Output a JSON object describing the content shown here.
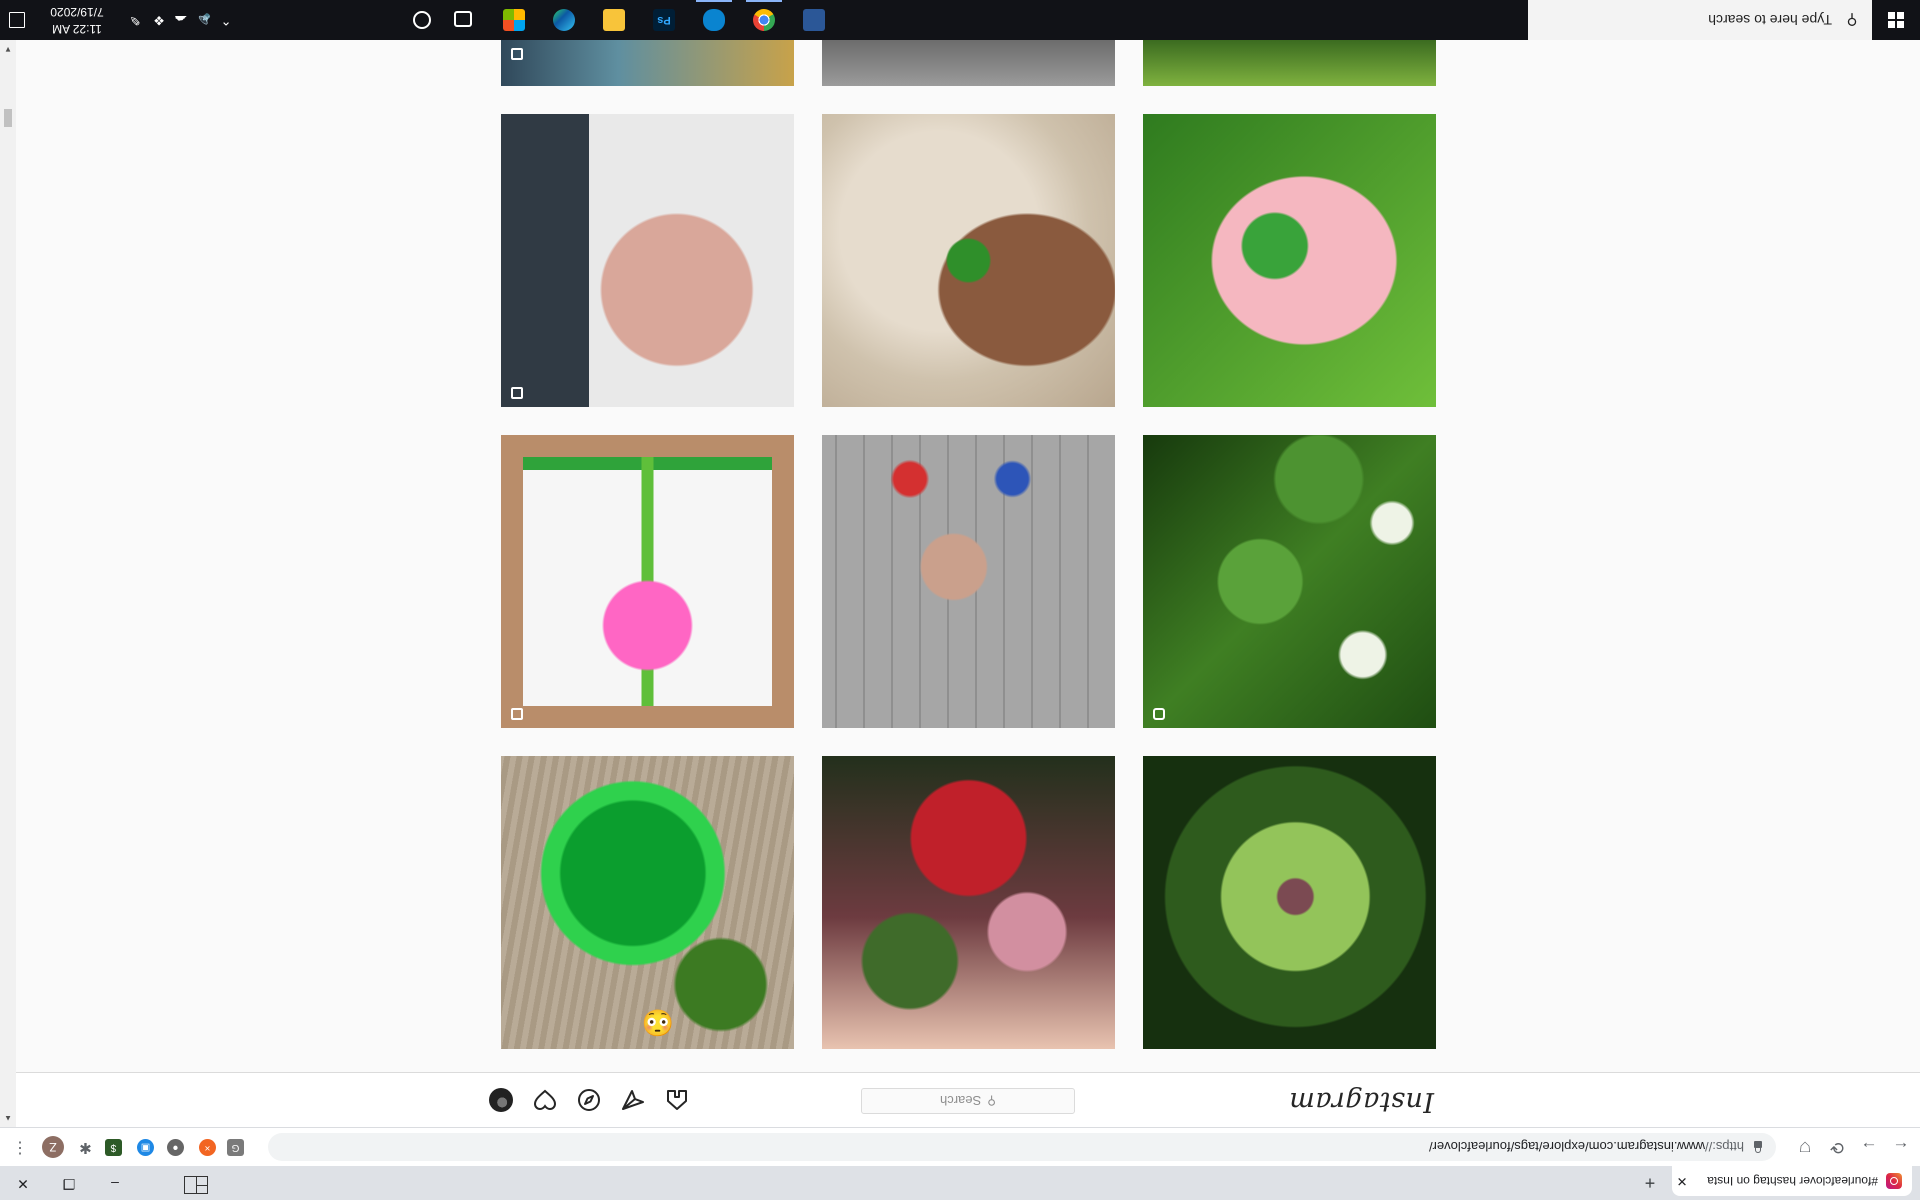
{
  "browser": {
    "tab_title": "#fourleafclover hashtag on Insta",
    "tab_close": "✕",
    "new_tab": "+",
    "url_scheme": "https://",
    "url_rest": "www.instagram.com/explore/tags/fourleafclover/",
    "profile_initial": "Z",
    "menu": "⋮",
    "back": "←",
    "forward": "→",
    "reload": "⟳",
    "minimize": "–",
    "restore": "❐",
    "close": "✕"
  },
  "instagram": {
    "logo": "Instagram",
    "search_placeholder": "Search",
    "search_icon": "⚲"
  },
  "grid": {
    "tiles": [
      {
        "name": "post-oxalis-clover",
        "icon": "none"
      },
      {
        "name": "post-fantasy-art",
        "icon": "none"
      },
      {
        "name": "post-green-cap-clover",
        "icon": "emoji"
      },
      {
        "name": "post-white-clover-field",
        "icon": "video-icon"
      },
      {
        "name": "post-pavement-clover",
        "icon": "none"
      },
      {
        "name": "post-paper-flower-craft",
        "icon": "carousel-icon"
      },
      {
        "name": "post-pink-hand-clover",
        "icon": "none"
      },
      {
        "name": "post-hand-clover",
        "icon": "none"
      },
      {
        "name": "post-tattoo-clover",
        "icon": "carousel-icon"
      }
    ],
    "emoji": "😳"
  },
  "taskbar": {
    "search_placeholder": "Type here to search",
    "time": "11:22 AM",
    "date": "7/19/2020",
    "apps": [
      "cortana-icon",
      "task-view-icon",
      "windows-store-icon",
      "edge-icon",
      "file-explorer-icon",
      "photoshop-icon",
      "onedrive-icon",
      "chrome-icon",
      "people-icon"
    ],
    "photoshop_label": "Ps"
  },
  "colors": {
    "instagram_text": "#262626",
    "taskbar_bg": "#111217",
    "page_bg": "#fafafa"
  }
}
